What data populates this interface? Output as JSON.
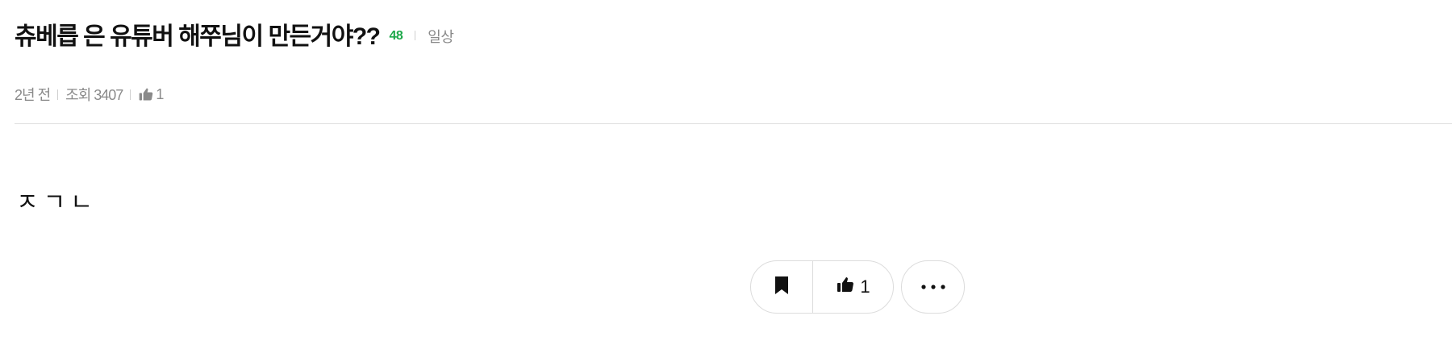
{
  "post": {
    "title": "츄베릅 은 유튜버 해쭈님이 만든거야??",
    "comment_count": "48",
    "category": "일상",
    "meta": {
      "time_ago": "2년 전",
      "views": "조회 3407",
      "likes": "1"
    },
    "body": "ㅈㄱㄴ"
  },
  "actions": {
    "like_count": "1"
  },
  "icons": {
    "like": "thumbs-up-icon",
    "bookmark": "bookmark-icon",
    "more": "more-horizontal-icon"
  },
  "colors": {
    "comment_count": "#1ea84a",
    "meta_text": "#8a8a8a",
    "border": "#dcdcdc"
  }
}
